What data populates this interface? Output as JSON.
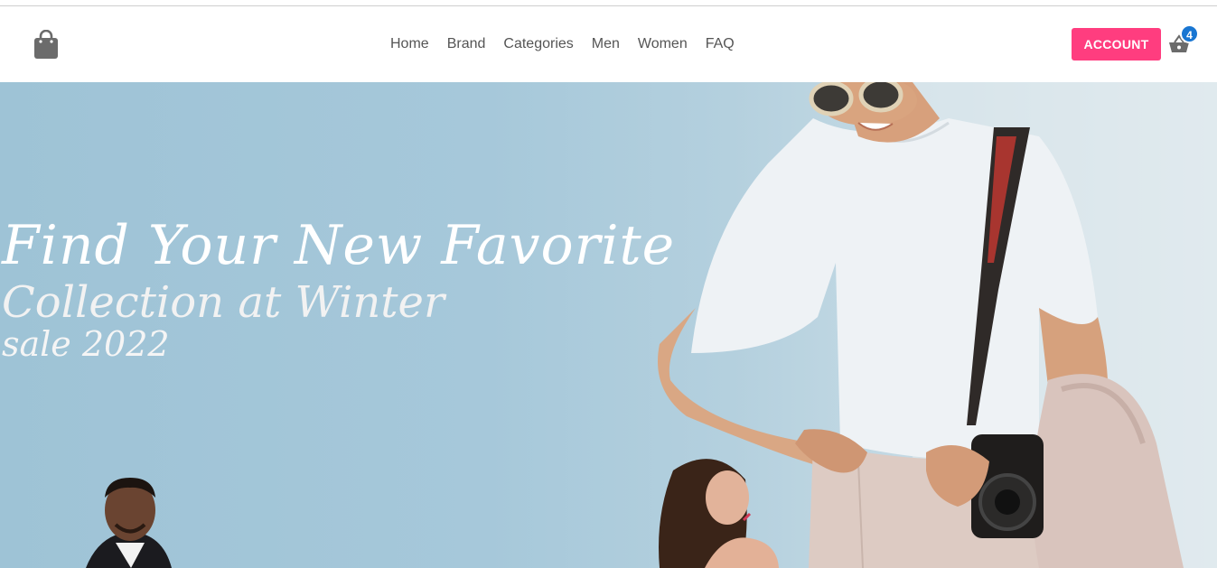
{
  "header": {
    "logo_icon": "shopping-bag-icon",
    "nav": [
      "Home",
      "Brand",
      "Categories",
      "Men",
      "Women",
      "FAQ"
    ],
    "account_label": "ACCOUNT",
    "cart_icon": "basket-icon",
    "cart_count": "4"
  },
  "hero": {
    "line1": "Find Your New Favorite",
    "line2": "Collection at Winter",
    "line3": "sale 2022"
  },
  "colors": {
    "accent": "#ff3d7f",
    "badge": "#1976d2",
    "hero_bg": "#a6c8da"
  }
}
